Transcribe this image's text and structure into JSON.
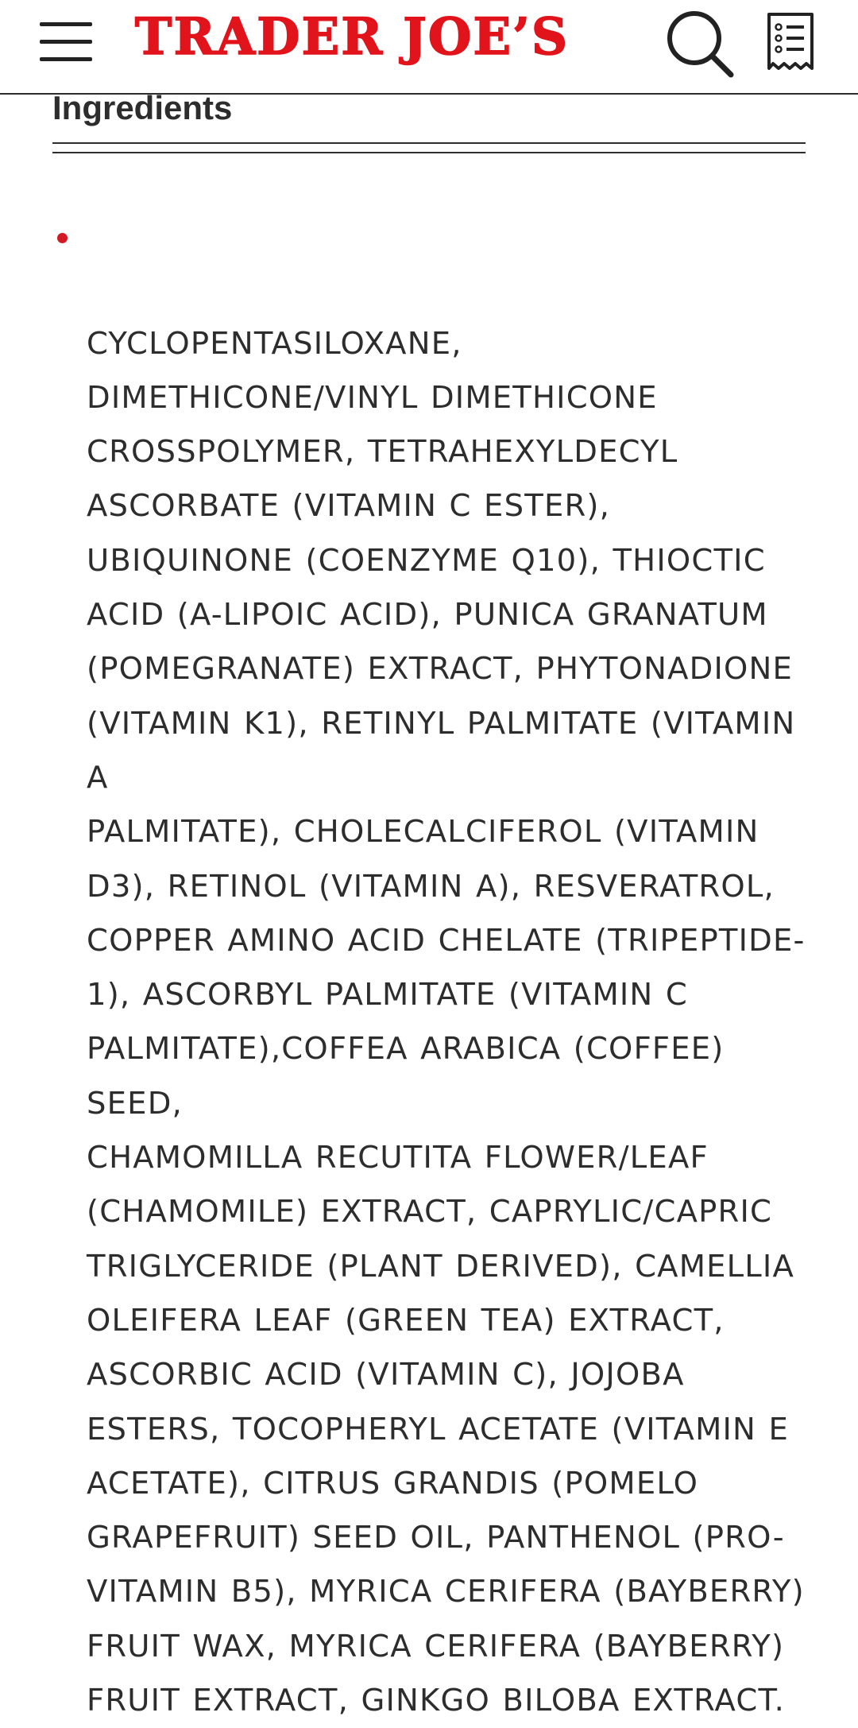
{
  "header": {
    "logo_text": "TRADER JOE’S",
    "brand_color": "#e1131b",
    "icons": {
      "menu": "hamburger-menu-icon",
      "search": "search-icon",
      "shopping_list": "shopping-list-icon"
    }
  },
  "section": {
    "title": "Ingredients"
  },
  "ingredients": {
    "bullet_color": "#d31a24",
    "text": "CYCLOPENTASILOXANE,\nDIMETHICONE/VINYL DIMETHICONE\nCROSSPOLYMER, TETRAHEXYLDECYL\nASCORBATE (VITAMIN C ESTER),\nUBIQUINONE (COENZYME Q10), THIOCTIC\nACID (A-LIPOIC ACID), PUNICA GRANATUM\n(POMEGRANATE) EXTRACT, PHYTONADIONE\n(VITAMIN K1), RETINYL PALMITATE (VITAMIN A\nPALMITATE), CHOLECALCIFEROL (VITAMIN\nD3), RETINOL (VITAMIN A), RESVERATROL,\nCOPPER AMINO ACID CHELATE (TRIPEPTIDE-\n1), ASCORBYL PALMITATE (VITAMIN C\nPALMITATE),COFFEA ARABICA (COFFEE) SEED,\nCHAMOMILLA RECUTITA FLOWER/LEAF\n(CHAMOMILE) EXTRACT, CAPRYLIC/CAPRIC\nTRIGLYCERIDE (PLANT DERIVED), CAMELLIA\nOLEIFERA LEAF (GREEN TEA) EXTRACT,\nASCORBIC ACID (VITAMIN C), JOJOBA\nESTERS, TOCOPHERYL ACETATE (VITAMIN E\nACETATE), CITRUS GRANDIS (POMELO\nGRAPEFRUIT) SEED OIL, PANTHENOL (PRO-\nVITAMIN B5), MYRICA CERIFERA (BAYBERRY)\nFRUIT WAX, MYRICA CERIFERA (BAYBERRY)\nFRUIT EXTRACT, GINKGO BILOBA EXTRACT."
  }
}
